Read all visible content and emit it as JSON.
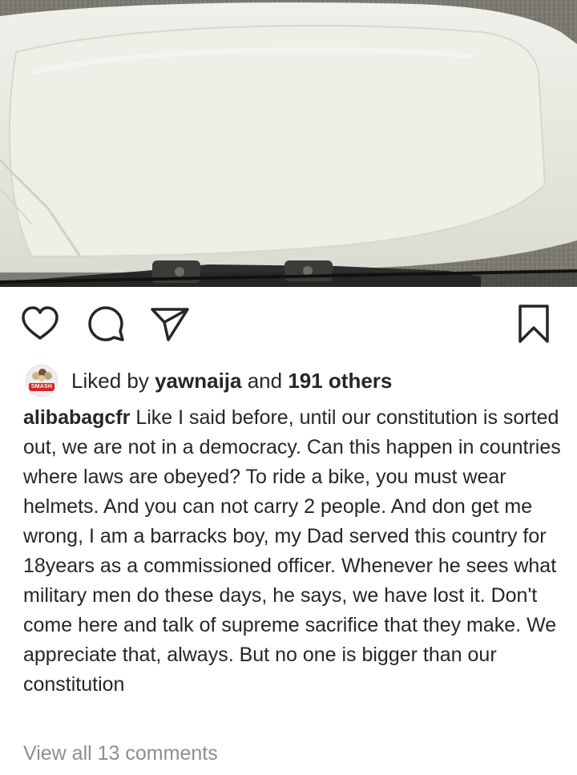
{
  "post": {
    "image_alt": "close-up of white vehicle hood with windshield wiper"
  },
  "actions": {
    "like_icon": "heart-icon",
    "comment_icon": "comment-bubble-icon",
    "share_icon": "paper-plane-icon",
    "save_icon": "bookmark-icon"
  },
  "likes": {
    "prefix": "Liked by ",
    "user": "yawnaija",
    "middle": " and ",
    "count": "191 others",
    "avatar_text": "SMASH"
  },
  "caption": {
    "username": "alibabagcfr",
    "text": " Like I said before, until our constitution is sorted out, we are not in a democracy. Can this happen in countries where laws are obeyed? To ride a bike, you must wear helmets. And you can not carry 2 people. And don get me wrong, I am a barracks boy, my Dad served this country for 18years as a commissioned officer. Whenever he sees what military men do these days, he says, we have lost it. Don't come here and talk of supreme sacrifice that they make. We appreciate that, always. But no one is bigger than our constitution"
  },
  "comments": {
    "view_all_label": "View all 13 comments"
  },
  "colors": {
    "text": "#262626",
    "muted": "#8e8e8e",
    "background": "#ffffff"
  }
}
